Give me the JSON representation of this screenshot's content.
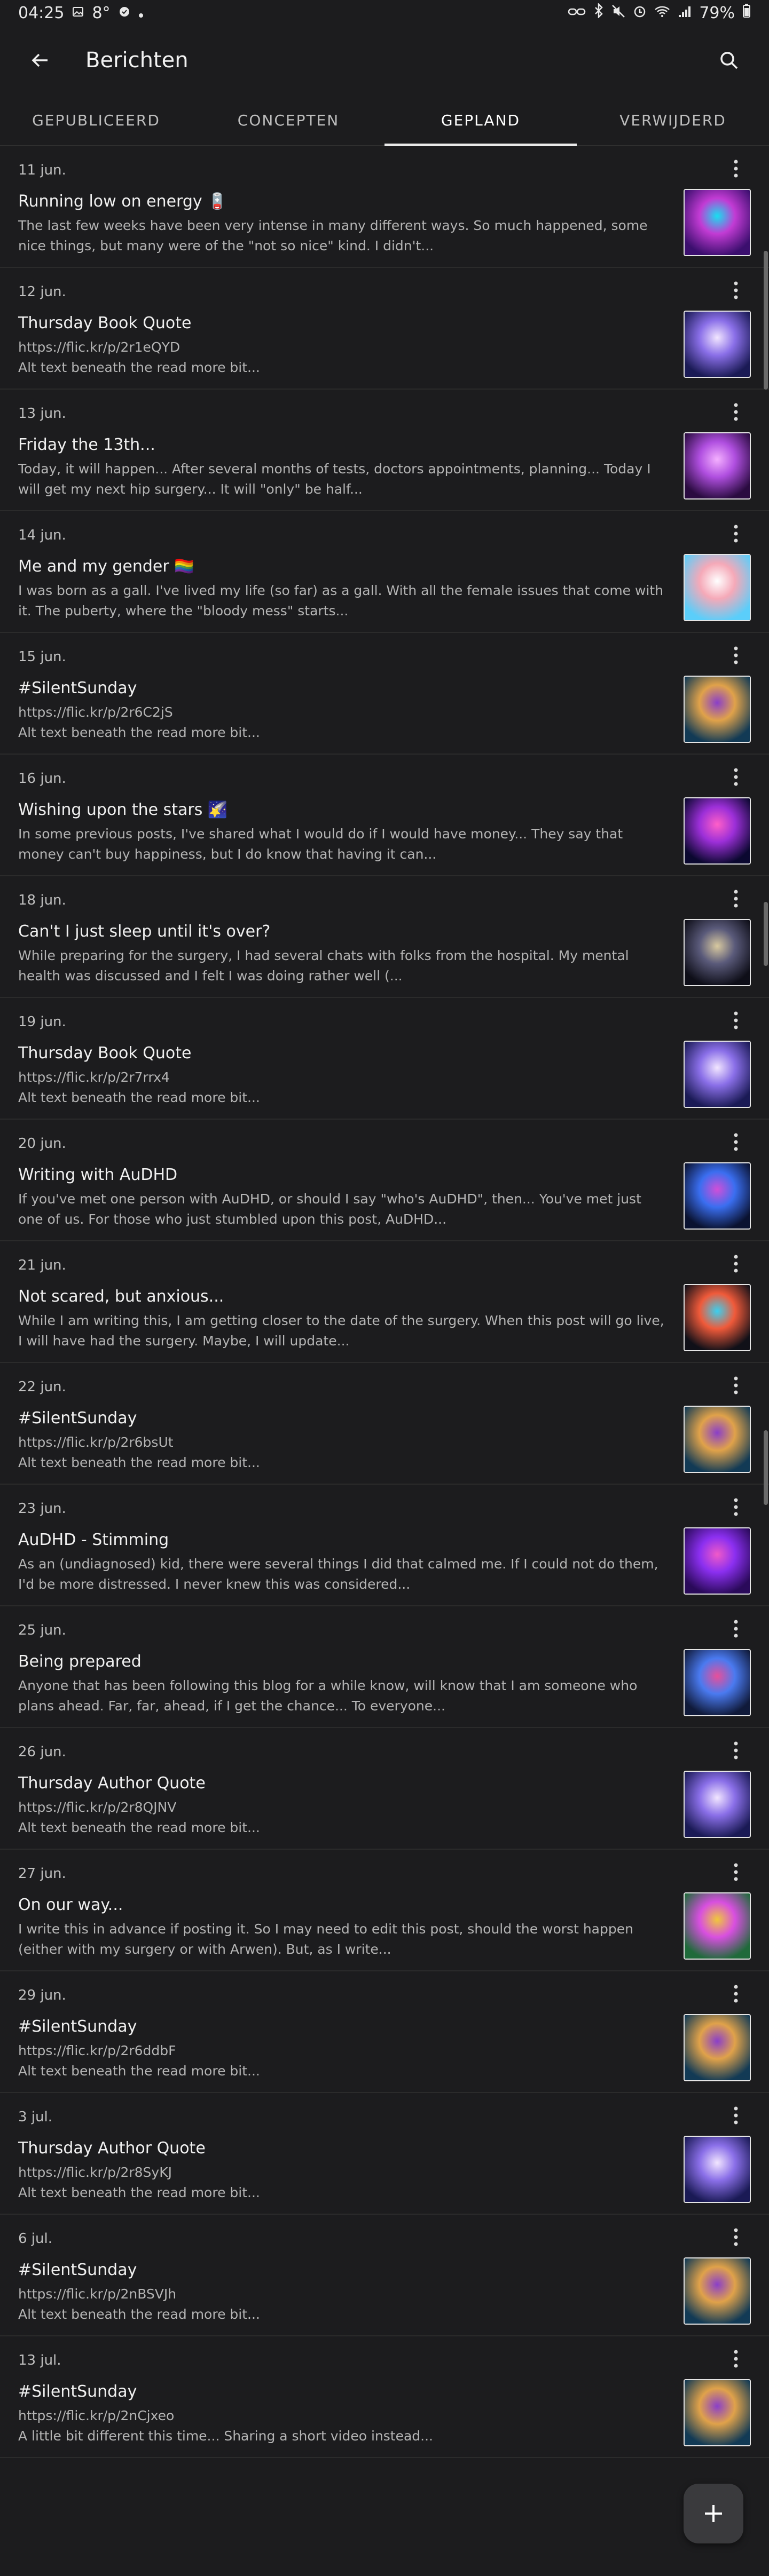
{
  "status_bar": {
    "time": "04:25",
    "temperature": "8°",
    "battery": "79%"
  },
  "header": {
    "title": "Berichten"
  },
  "tabs": [
    {
      "label": "GEPUBLICEERD",
      "active": false
    },
    {
      "label": "CONCEPTEN",
      "active": false
    },
    {
      "label": "GEPLAND",
      "active": true
    },
    {
      "label": "VERWIJDERD",
      "active": false
    }
  ],
  "posts": [
    {
      "date": "11 jun.",
      "title": "Running low on energy 🪫",
      "excerpt": "The last few weeks have been very intense in many different ways. So much happened, some nice things, but many were of the \"not so nice\" kind. I didn't...",
      "thumb_colors": [
        "#3b0f6e",
        "#c23bd4",
        "#16e0f0"
      ]
    },
    {
      "date": "12 jun.",
      "title": "Thursday Book Quote",
      "excerpt": "https://flic.kr/p/2r1eQYD\nAlt text beneath the read more bit...",
      "thumb_colors": [
        "#1a1a55",
        "#8a6fe8",
        "#f2e6ff"
      ]
    },
    {
      "date": "13 jun.",
      "title": "Friday the 13th...",
      "excerpt": "Today, it will happen... After several months of tests, doctors appointments, planning... Today I will get my next hip surgery... It will \"only\" be half...",
      "thumb_colors": [
        "#2a0b40",
        "#b04fe0",
        "#f4b0ff"
      ]
    },
    {
      "date": "14 jun.",
      "title": "Me and my gender 🏳️‍🌈",
      "excerpt": "I was born as a gall. I've lived my life (so far) as a gall. With all the female issues that come with it. The puberty, where the \"bloody mess\" starts...",
      "thumb_colors": [
        "#5bcefa",
        "#f5a9b8",
        "#ffffff"
      ]
    },
    {
      "date": "15 jun.",
      "title": "#SilentSunday",
      "excerpt": "https://flic.kr/p/2r6C2jS\nAlt text beneath the read more bit...",
      "thumb_colors": [
        "#123a55",
        "#e0a24a",
        "#8a3fc9"
      ]
    },
    {
      "date": "16 jun.",
      "title": "Wishing upon the stars 🌠",
      "excerpt": "In some previous posts, I've shared what I would do if I would have money... They say that money can't buy happiness, but I do know that having it can...",
      "thumb_colors": [
        "#0b0830",
        "#9c2fd8",
        "#ff5fc8"
      ]
    },
    {
      "date": "18 jun.",
      "title": "Can't I just sleep until it's over?",
      "excerpt": "While preparing for the surgery, I had several chats with folks from the hospital. My mental health was discussed and I felt I was doing rather well (...",
      "thumb_colors": [
        "#0e0e18",
        "#5a5a7a",
        "#d8c9a0"
      ]
    },
    {
      "date": "19 jun.",
      "title": "Thursday Book Quote",
      "excerpt": "https://flic.kr/p/2r7rrx4\nAlt text beneath the read more bit...",
      "thumb_colors": [
        "#1a1a55",
        "#8a6fe8",
        "#f2e6ff"
      ]
    },
    {
      "date": "20 jun.",
      "title": "Writing with AuDHD",
      "excerpt": "If you've met one person with AuDHD, or should I say \"who's AuDHD\", then... You've met just one of us. For those who just stumbled upon this post, AuDHD...",
      "thumb_colors": [
        "#0a1230",
        "#3a6ef0",
        "#d14fd8"
      ]
    },
    {
      "date": "21 jun.",
      "title": "Not scared, but anxious...",
      "excerpt": "While I am writing this, I am getting closer to the date of the surgery. When this post will go live, I will have had the surgery. Maybe, I will update...",
      "thumb_colors": [
        "#101018",
        "#f05a3a",
        "#3ad0f0"
      ]
    },
    {
      "date": "22 jun.",
      "title": "#SilentSunday",
      "excerpt": "https://flic.kr/p/2r6bsUt\nAlt text beneath the read more bit...",
      "thumb_colors": [
        "#123a55",
        "#e0a24a",
        "#8a3fc9"
      ]
    },
    {
      "date": "23 jun.",
      "title": "AuDHD - Stimming",
      "excerpt": "As an (undiagnosed) kid, there were several things I did that calmed me. If I could not do them, I'd be more distressed. I never knew this was considered...",
      "thumb_colors": [
        "#2a0a5a",
        "#8b2ff0",
        "#f05ac8"
      ]
    },
    {
      "date": "25 jun.",
      "title": "Being prepared",
      "excerpt": "Anyone that has been following this blog for a while know, will know that I am someone who plans ahead. Far, far, ahead, if I get the chance... To everyone...",
      "thumb_colors": [
        "#101a3a",
        "#4a7af0",
        "#e84f9a"
      ]
    },
    {
      "date": "26 jun.",
      "title": "Thursday Author Quote",
      "excerpt": "https://flic.kr/p/2r8QJNV\nAlt text beneath the read more bit...",
      "thumb_colors": [
        "#1a1a55",
        "#8a6fe8",
        "#f2e6ff"
      ]
    },
    {
      "date": "27 jun.",
      "title": "On our way...",
      "excerpt": "I write this in advance if posting it. So I may need to edit this post, should the worst happen (either with my surgery or with Arwen). But, as I write...",
      "thumb_colors": [
        "#1f6a3a",
        "#d84fe0",
        "#f0c83a"
      ]
    },
    {
      "date": "29 jun.",
      "title": "#SilentSunday",
      "excerpt": "https://flic.kr/p/2r6ddbF\nAlt text beneath the read more bit...",
      "thumb_colors": [
        "#123a55",
        "#e0a24a",
        "#8a3fc9"
      ]
    },
    {
      "date": "3 jul.",
      "title": "Thursday Author Quote",
      "excerpt": "https://flic.kr/p/2r8SyKJ\nAlt text beneath the read more bit...",
      "thumb_colors": [
        "#1a1a55",
        "#8a6fe8",
        "#f2e6ff"
      ]
    },
    {
      "date": "6 jul.",
      "title": "#SilentSunday",
      "excerpt": "https://flic.kr/p/2nBSVJh\nAlt text beneath the read more bit...",
      "thumb_colors": [
        "#123a55",
        "#e0a24a",
        "#8a3fc9"
      ]
    },
    {
      "date": "13 jul.",
      "title": "#SilentSunday",
      "excerpt": "https://flic.kr/p/2nCjxeo\nA little bit different this time... Sharing a short video instead...",
      "thumb_colors": [
        "#123a55",
        "#e0a24a",
        "#8a3fc9"
      ]
    }
  ],
  "fab": {
    "icon": "plus-icon"
  },
  "theme": {
    "background": "#1c1c1e",
    "divider": "#2b2b2b",
    "text": "#f0f0f0",
    "muted": "#b4b4b4"
  }
}
